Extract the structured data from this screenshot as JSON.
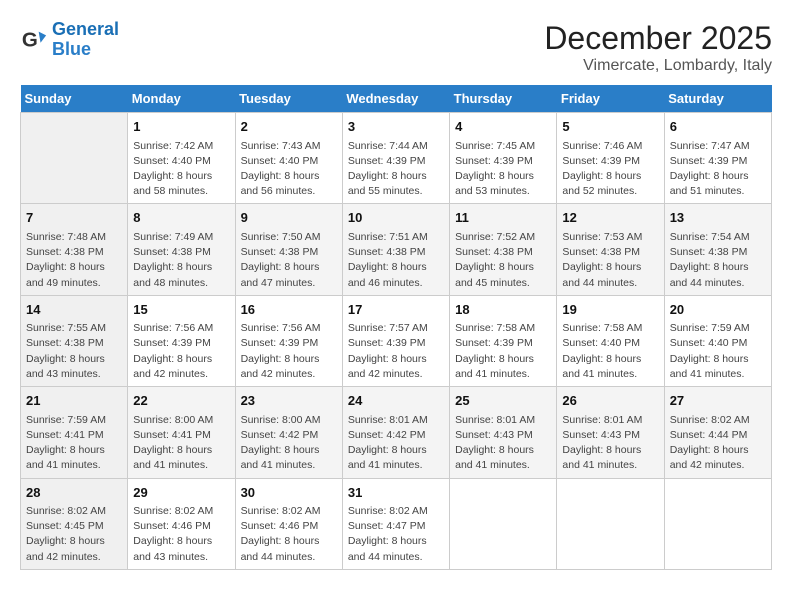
{
  "logo": {
    "line1": "General",
    "line2": "Blue"
  },
  "title": "December 2025",
  "subtitle": "Vimercate, Lombardy, Italy",
  "days_of_week": [
    "Sunday",
    "Monday",
    "Tuesday",
    "Wednesday",
    "Thursday",
    "Friday",
    "Saturday"
  ],
  "weeks": [
    [
      {
        "num": "",
        "sunrise": "",
        "sunset": "",
        "daylight": ""
      },
      {
        "num": "1",
        "sunrise": "Sunrise: 7:42 AM",
        "sunset": "Sunset: 4:40 PM",
        "daylight": "Daylight: 8 hours and 58 minutes."
      },
      {
        "num": "2",
        "sunrise": "Sunrise: 7:43 AM",
        "sunset": "Sunset: 4:40 PM",
        "daylight": "Daylight: 8 hours and 56 minutes."
      },
      {
        "num": "3",
        "sunrise": "Sunrise: 7:44 AM",
        "sunset": "Sunset: 4:39 PM",
        "daylight": "Daylight: 8 hours and 55 minutes."
      },
      {
        "num": "4",
        "sunrise": "Sunrise: 7:45 AM",
        "sunset": "Sunset: 4:39 PM",
        "daylight": "Daylight: 8 hours and 53 minutes."
      },
      {
        "num": "5",
        "sunrise": "Sunrise: 7:46 AM",
        "sunset": "Sunset: 4:39 PM",
        "daylight": "Daylight: 8 hours and 52 minutes."
      },
      {
        "num": "6",
        "sunrise": "Sunrise: 7:47 AM",
        "sunset": "Sunset: 4:39 PM",
        "daylight": "Daylight: 8 hours and 51 minutes."
      }
    ],
    [
      {
        "num": "7",
        "sunrise": "Sunrise: 7:48 AM",
        "sunset": "Sunset: 4:38 PM",
        "daylight": "Daylight: 8 hours and 49 minutes."
      },
      {
        "num": "8",
        "sunrise": "Sunrise: 7:49 AM",
        "sunset": "Sunset: 4:38 PM",
        "daylight": "Daylight: 8 hours and 48 minutes."
      },
      {
        "num": "9",
        "sunrise": "Sunrise: 7:50 AM",
        "sunset": "Sunset: 4:38 PM",
        "daylight": "Daylight: 8 hours and 47 minutes."
      },
      {
        "num": "10",
        "sunrise": "Sunrise: 7:51 AM",
        "sunset": "Sunset: 4:38 PM",
        "daylight": "Daylight: 8 hours and 46 minutes."
      },
      {
        "num": "11",
        "sunrise": "Sunrise: 7:52 AM",
        "sunset": "Sunset: 4:38 PM",
        "daylight": "Daylight: 8 hours and 45 minutes."
      },
      {
        "num": "12",
        "sunrise": "Sunrise: 7:53 AM",
        "sunset": "Sunset: 4:38 PM",
        "daylight": "Daylight: 8 hours and 44 minutes."
      },
      {
        "num": "13",
        "sunrise": "Sunrise: 7:54 AM",
        "sunset": "Sunset: 4:38 PM",
        "daylight": "Daylight: 8 hours and 44 minutes."
      }
    ],
    [
      {
        "num": "14",
        "sunrise": "Sunrise: 7:55 AM",
        "sunset": "Sunset: 4:38 PM",
        "daylight": "Daylight: 8 hours and 43 minutes."
      },
      {
        "num": "15",
        "sunrise": "Sunrise: 7:56 AM",
        "sunset": "Sunset: 4:39 PM",
        "daylight": "Daylight: 8 hours and 42 minutes."
      },
      {
        "num": "16",
        "sunrise": "Sunrise: 7:56 AM",
        "sunset": "Sunset: 4:39 PM",
        "daylight": "Daylight: 8 hours and 42 minutes."
      },
      {
        "num": "17",
        "sunrise": "Sunrise: 7:57 AM",
        "sunset": "Sunset: 4:39 PM",
        "daylight": "Daylight: 8 hours and 42 minutes."
      },
      {
        "num": "18",
        "sunrise": "Sunrise: 7:58 AM",
        "sunset": "Sunset: 4:39 PM",
        "daylight": "Daylight: 8 hours and 41 minutes."
      },
      {
        "num": "19",
        "sunrise": "Sunrise: 7:58 AM",
        "sunset": "Sunset: 4:40 PM",
        "daylight": "Daylight: 8 hours and 41 minutes."
      },
      {
        "num": "20",
        "sunrise": "Sunrise: 7:59 AM",
        "sunset": "Sunset: 4:40 PM",
        "daylight": "Daylight: 8 hours and 41 minutes."
      }
    ],
    [
      {
        "num": "21",
        "sunrise": "Sunrise: 7:59 AM",
        "sunset": "Sunset: 4:41 PM",
        "daylight": "Daylight: 8 hours and 41 minutes."
      },
      {
        "num": "22",
        "sunrise": "Sunrise: 8:00 AM",
        "sunset": "Sunset: 4:41 PM",
        "daylight": "Daylight: 8 hours and 41 minutes."
      },
      {
        "num": "23",
        "sunrise": "Sunrise: 8:00 AM",
        "sunset": "Sunset: 4:42 PM",
        "daylight": "Daylight: 8 hours and 41 minutes."
      },
      {
        "num": "24",
        "sunrise": "Sunrise: 8:01 AM",
        "sunset": "Sunset: 4:42 PM",
        "daylight": "Daylight: 8 hours and 41 minutes."
      },
      {
        "num": "25",
        "sunrise": "Sunrise: 8:01 AM",
        "sunset": "Sunset: 4:43 PM",
        "daylight": "Daylight: 8 hours and 41 minutes."
      },
      {
        "num": "26",
        "sunrise": "Sunrise: 8:01 AM",
        "sunset": "Sunset: 4:43 PM",
        "daylight": "Daylight: 8 hours and 41 minutes."
      },
      {
        "num": "27",
        "sunrise": "Sunrise: 8:02 AM",
        "sunset": "Sunset: 4:44 PM",
        "daylight": "Daylight: 8 hours and 42 minutes."
      }
    ],
    [
      {
        "num": "28",
        "sunrise": "Sunrise: 8:02 AM",
        "sunset": "Sunset: 4:45 PM",
        "daylight": "Daylight: 8 hours and 42 minutes."
      },
      {
        "num": "29",
        "sunrise": "Sunrise: 8:02 AM",
        "sunset": "Sunset: 4:46 PM",
        "daylight": "Daylight: 8 hours and 43 minutes."
      },
      {
        "num": "30",
        "sunrise": "Sunrise: 8:02 AM",
        "sunset": "Sunset: 4:46 PM",
        "daylight": "Daylight: 8 hours and 44 minutes."
      },
      {
        "num": "31",
        "sunrise": "Sunrise: 8:02 AM",
        "sunset": "Sunset: 4:47 PM",
        "daylight": "Daylight: 8 hours and 44 minutes."
      },
      {
        "num": "",
        "sunrise": "",
        "sunset": "",
        "daylight": ""
      },
      {
        "num": "",
        "sunrise": "",
        "sunset": "",
        "daylight": ""
      },
      {
        "num": "",
        "sunrise": "",
        "sunset": "",
        "daylight": ""
      }
    ]
  ]
}
